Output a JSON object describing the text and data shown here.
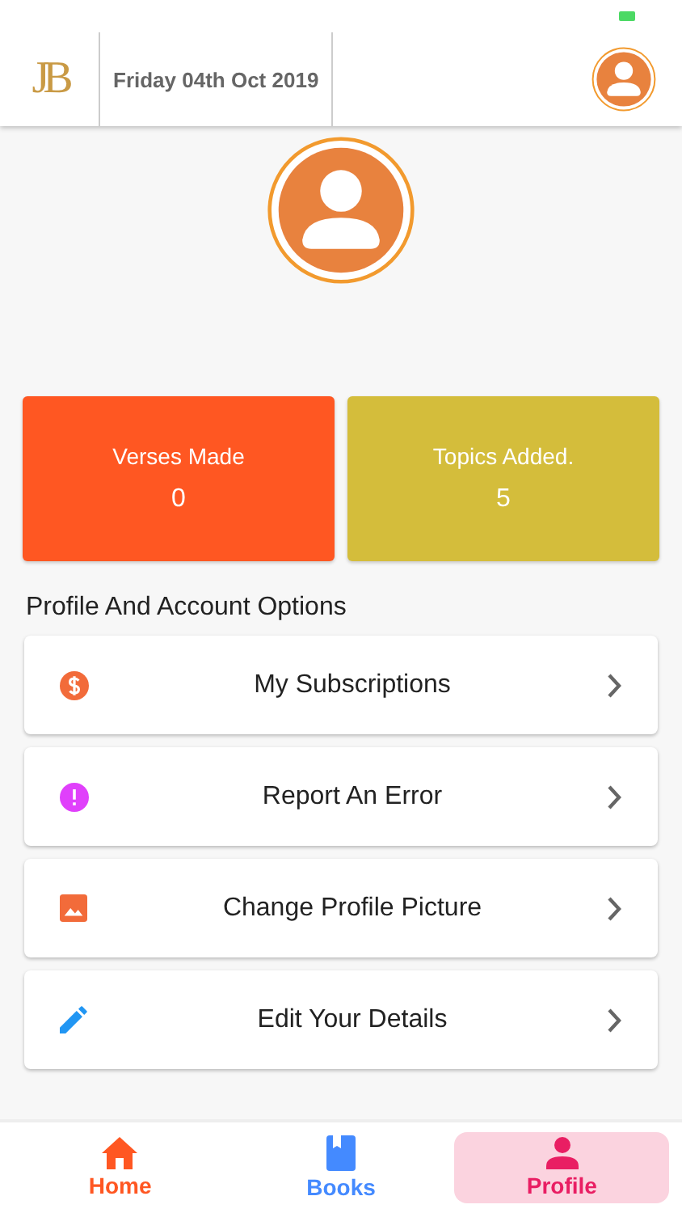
{
  "header": {
    "logo": "JB",
    "date": "Friday 04th Oct 2019"
  },
  "stats": [
    {
      "label": "Verses Made",
      "value": "0",
      "color": "#ff5722"
    },
    {
      "label": "Topics Added.",
      "value": "5",
      "color": "#d4bd3b"
    }
  ],
  "section_title": "Profile And Account Options",
  "options": [
    {
      "kind": "subscription",
      "label": "My Subscriptions"
    },
    {
      "kind": "error",
      "label": "Report An Error"
    },
    {
      "kind": "picture",
      "label": "Change Profile Picture"
    },
    {
      "kind": "edit",
      "label": "Edit Your Details"
    }
  ],
  "nav": [
    {
      "kind": "home",
      "label": "Home",
      "color": "#ff5722",
      "selected": false
    },
    {
      "kind": "books",
      "label": "Books",
      "color": "#448aff",
      "selected": false
    },
    {
      "kind": "profile",
      "label": "Profile",
      "color": "#e91e63",
      "selected": true
    }
  ]
}
